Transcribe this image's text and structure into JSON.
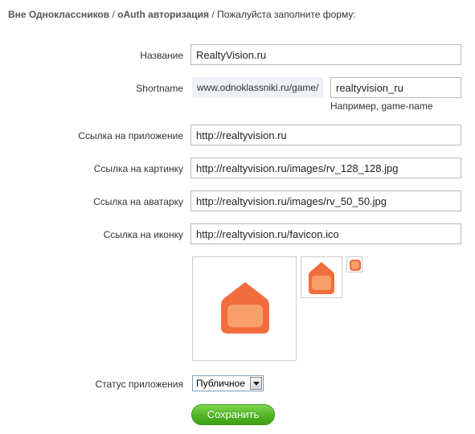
{
  "breadcrumb": {
    "part1": "Вне Одноклассников",
    "separator": "/",
    "part2": "oAuth авторизация",
    "current": "Пожалуйста заполните форму:"
  },
  "form": {
    "name": {
      "label": "Название",
      "value": "RealtyVision.ru"
    },
    "shortname": {
      "label": "Shortname",
      "prefix": "www.odnoklassniki.ru/game/",
      "value": "realtyvision_ru",
      "hint": "Например, game-name"
    },
    "app_link": {
      "label": "Ссылка на приложение",
      "value": "http://realtyvision.ru"
    },
    "picture_link": {
      "label": "Ссылка на картинку",
      "value": "http://realtyvision.ru/images/rv_128_128.jpg"
    },
    "avatar_link": {
      "label": "Ссылка на аватарку",
      "value": "http://realtyvision.ru/images/rv_50_50.jpg"
    },
    "icon_link": {
      "label": "Ссылка на иконку",
      "value": "http://realtyvision.ru/favicon.ico"
    },
    "status": {
      "label": "Статус приложения",
      "selected": "Публичное"
    },
    "save_label": "Сохранить"
  },
  "colors": {
    "logo_dark": "#f26d3d",
    "logo_light": "#f9a06a",
    "button_green": "#4fb423"
  },
  "icons": {
    "large_preview": "house-logo-icon",
    "medium_preview": "house-logo-icon",
    "small_preview": "favicon-icon",
    "select_arrow": "chevron-down-icon"
  }
}
